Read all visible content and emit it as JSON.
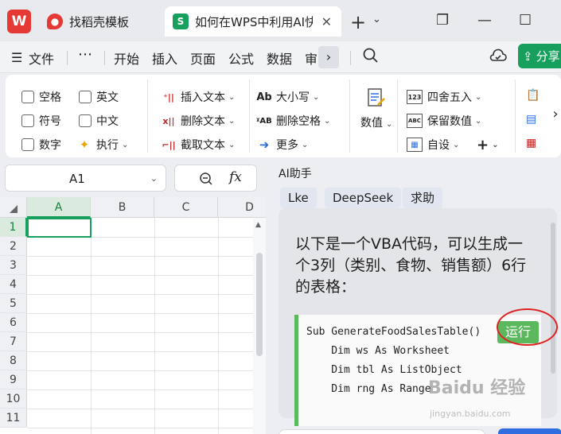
{
  "titlebar": {
    "logo": "W",
    "tabs": [
      {
        "label": "找稻壳模板",
        "icon": "docer-icon"
      },
      {
        "label": "如何在WPS中利用AI快速生成表格",
        "icon": "spreadsheet-icon",
        "icon_text": "S"
      }
    ],
    "new_tab": "+",
    "controls": {
      "restore": "❐",
      "minimize": "—",
      "maximize": "☐"
    }
  },
  "menubar": {
    "file": "文件",
    "more": "⋯",
    "items": [
      "开始",
      "插入",
      "页面",
      "公式",
      "数据",
      "审"
    ],
    "share": "分享"
  },
  "ribbon": {
    "checks": [
      "空格",
      "英文",
      "符号",
      "中文",
      "数字"
    ],
    "execute": "执行",
    "text_ops": [
      "插入文本",
      "删除文本",
      "截取文本"
    ],
    "case_ops": [
      "大小写",
      "删除空格",
      "更多"
    ],
    "numeric": "数值",
    "num_ops": [
      "四舍五入",
      "保留数值",
      "自设"
    ],
    "plus": "+"
  },
  "namebox": {
    "value": "A1"
  },
  "formula": {
    "fx": "fx"
  },
  "grid": {
    "columns": [
      "A",
      "B",
      "C",
      "D"
    ],
    "rows": [
      "1",
      "2",
      "3",
      "4",
      "5",
      "6",
      "7",
      "8",
      "9",
      "10",
      "11"
    ]
  },
  "ai_panel": {
    "title": "AI助手",
    "tabs": [
      "Lke",
      "DeepSeek",
      "求助"
    ],
    "message_lines": [
      "以下是一个VBA代码，可以生成一",
      "个3列（类别、食物、销售额）6行",
      "的表格："
    ],
    "code_lines": [
      "Sub GenerateFoodSalesTable()",
      "    Dim ws As Worksheet",
      "    Dim tbl As ListObject",
      "    Dim rng As Range"
    ],
    "run_button": "运行"
  },
  "watermark": {
    "text": "Baidu 经验",
    "url": "jingyan.baidu.com"
  },
  "colors": {
    "accent": "#17a05d",
    "run": "#5cb85c",
    "annotation": "#e02020"
  }
}
